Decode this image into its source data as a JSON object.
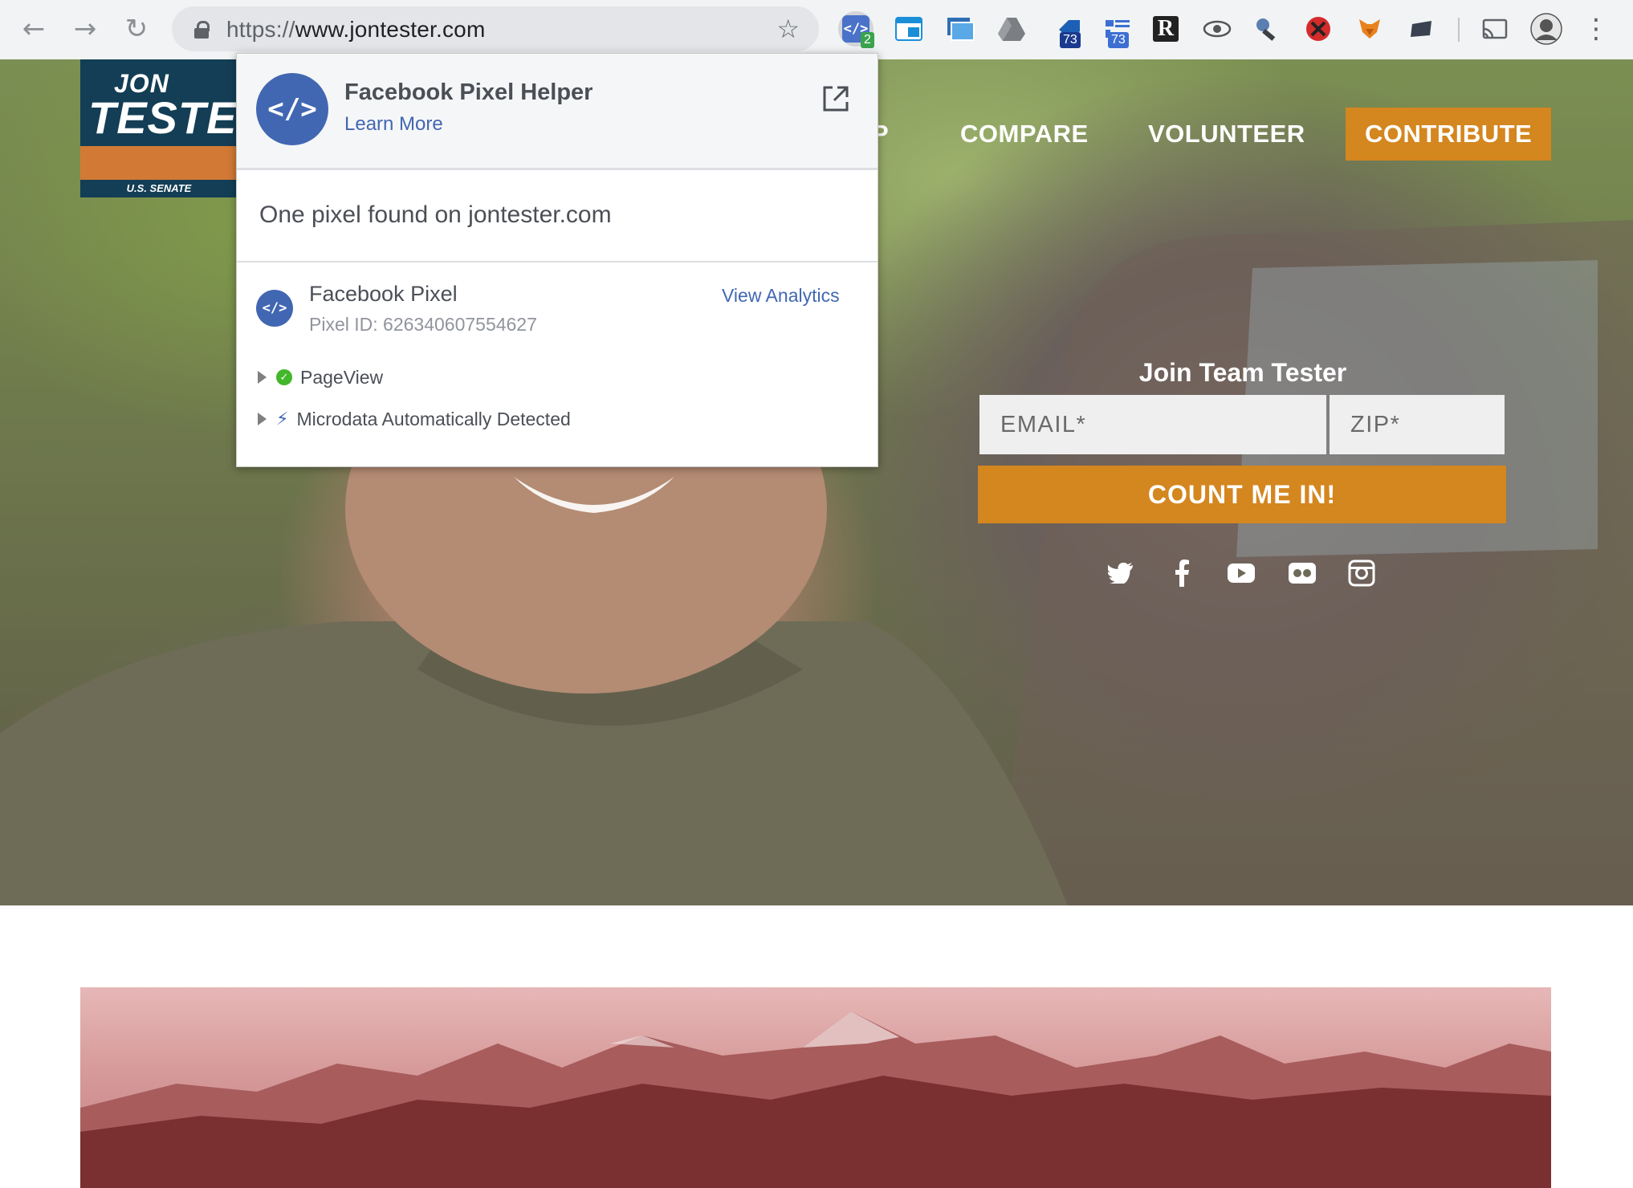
{
  "browser": {
    "url_scheme": "https://",
    "url_host": "www.jontester.com",
    "back_glyph": "←",
    "forward_glyph": "→",
    "reload_glyph": "↻",
    "star_glyph": "☆",
    "menu_glyph": "⋮",
    "extensions": [
      {
        "name": "facebook-pixel-helper-icon",
        "badge": "2",
        "badge_color": "#3aa34d"
      },
      {
        "name": "window-extension-icon"
      },
      {
        "name": "screenshot-extension-icon"
      },
      {
        "name": "google-drive-icon"
      },
      {
        "name": "tag-extension-icon",
        "badge": "73",
        "badge_color": "#1a3a8f"
      },
      {
        "name": "tag-manager-extension-icon",
        "badge": "73",
        "badge_color": "#3d6fd3"
      },
      {
        "name": "r-extension-icon",
        "label": "R"
      },
      {
        "name": "eye-extension-icon"
      },
      {
        "name": "key-extension-icon"
      },
      {
        "name": "red-block-icon"
      },
      {
        "name": "fox-extension-icon"
      },
      {
        "name": "dark-extension-icon"
      },
      {
        "name": "cast-icon"
      },
      {
        "name": "profile-avatar"
      }
    ]
  },
  "site": {
    "logo": {
      "line1": "JON",
      "line2": "TESTER",
      "line3": "U.S. SENATE"
    },
    "nav": {
      "partial": "P",
      "compare": "COMPARE",
      "volunteer": "VOLUNTEER",
      "contribute": "CONTRIBUTE"
    },
    "signup": {
      "title": "Join Team Tester",
      "email_placeholder": "EMAIL*",
      "zip_placeholder": "ZIP*",
      "button": "COUNT ME IN!"
    },
    "social": [
      "twitter",
      "facebook",
      "youtube",
      "flickr",
      "instagram"
    ],
    "accent_color": "#d4861f"
  },
  "popup": {
    "title": "Facebook Pixel Helper",
    "learn_more": "Learn More",
    "summary": "One pixel found on jontester.com",
    "pixel": {
      "name": "Facebook Pixel",
      "id_text": "Pixel ID: 626340607554627",
      "view_analytics": "View Analytics"
    },
    "events": [
      {
        "label": "PageView",
        "status": "success"
      },
      {
        "label": "Microdata Automatically Detected",
        "status": "info"
      }
    ],
    "icon_glyph": "</>"
  }
}
